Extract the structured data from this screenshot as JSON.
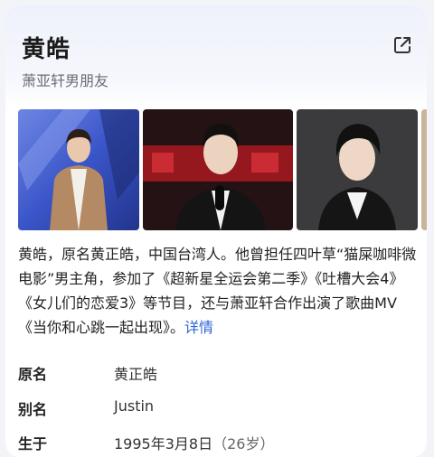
{
  "header": {
    "title": "黄皓",
    "subtitle": "萧亚轩男朋友",
    "share_icon": "external-share-icon"
  },
  "photos": {
    "count": 4,
    "colors": {
      "stage_bg": "#3a55c8",
      "coat": "#b38a63",
      "red_bg": "#a81a20",
      "dark_bg": "#2a2a2a"
    }
  },
  "description": {
    "text": "黄皓，原名黄正皓，中国台湾人。他曾担任四叶草“猫屎咖啡微电影”男主角，参加了《超新星全运会第二季》《吐槽大会4》《女儿们的恋爱3》等节目，还与萧亚轩合作出演了歌曲MV《当你和心跳一起出现》。",
    "more_link": "详情"
  },
  "info": [
    {
      "key": "原名",
      "value": "黄正皓"
    },
    {
      "key": "别名",
      "value": "Justin"
    },
    {
      "key": "生于",
      "value": "1995年3月8日",
      "extra": "（26岁）"
    }
  ],
  "colors": {
    "link": "#2f66d6",
    "title": "#1a1a1a",
    "subtitle": "#6a6d75"
  }
}
